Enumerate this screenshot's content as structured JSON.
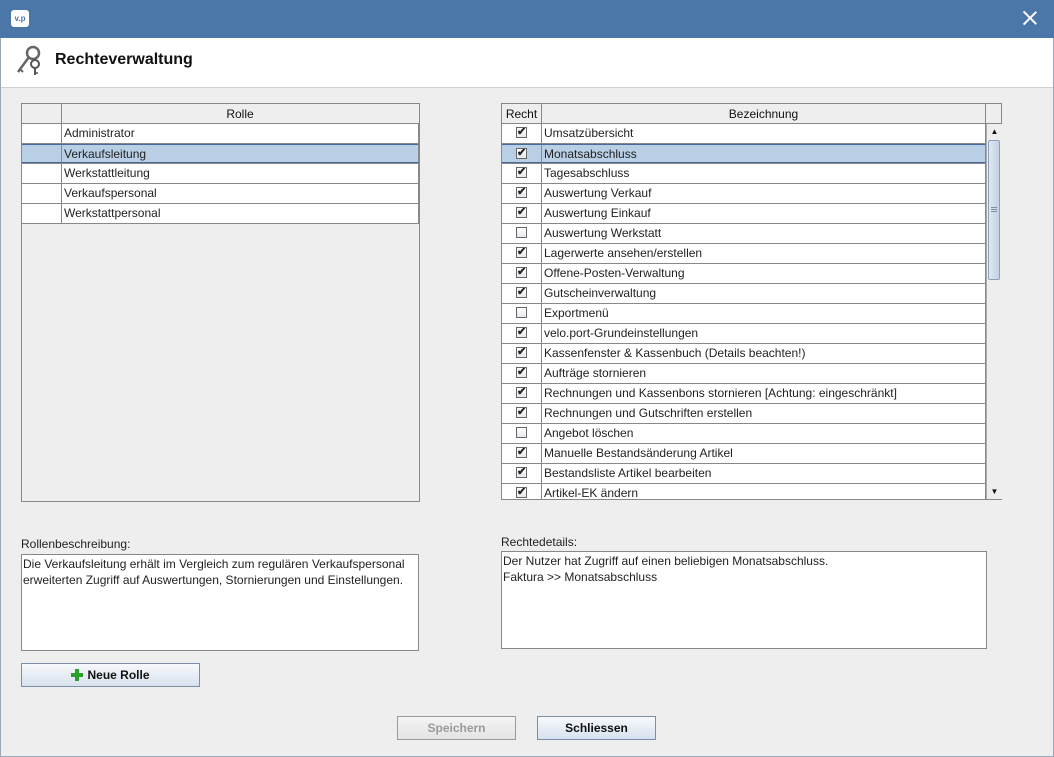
{
  "window": {
    "app_icon_text": "v.p",
    "header_title": "Rechteverwaltung"
  },
  "roles_table": {
    "columns": [
      "",
      "Rolle"
    ],
    "rows": [
      {
        "name": "Administrator",
        "selected": false
      },
      {
        "name": "Verkaufsleitung",
        "selected": true
      },
      {
        "name": "Werkstattleitung",
        "selected": false
      },
      {
        "name": "Verkaufspersonal",
        "selected": false
      },
      {
        "name": "Werkstattpersonal",
        "selected": false
      }
    ]
  },
  "rights_table": {
    "columns": [
      "Recht",
      "Bezeichnung"
    ],
    "rows": [
      {
        "checked": true,
        "label": "Umsatzübersicht",
        "selected": false
      },
      {
        "checked": true,
        "label": "Monatsabschluss",
        "selected": true
      },
      {
        "checked": true,
        "label": "Tagesabschluss",
        "selected": false
      },
      {
        "checked": true,
        "label": "Auswertung Verkauf",
        "selected": false
      },
      {
        "checked": true,
        "label": "Auswertung Einkauf",
        "selected": false
      },
      {
        "checked": false,
        "label": "Auswertung Werkstatt",
        "selected": false
      },
      {
        "checked": true,
        "label": "Lagerwerte ansehen/erstellen",
        "selected": false
      },
      {
        "checked": true,
        "label": "Offene-Posten-Verwaltung",
        "selected": false
      },
      {
        "checked": true,
        "label": "Gutscheinverwaltung",
        "selected": false
      },
      {
        "checked": false,
        "label": "Exportmenü",
        "selected": false
      },
      {
        "checked": true,
        "label": "velo.port-Grundeinstellungen",
        "selected": false
      },
      {
        "checked": true,
        "label": "Kassenfenster & Kassenbuch (Details beachten!)",
        "selected": false
      },
      {
        "checked": true,
        "label": "Aufträge stornieren",
        "selected": false
      },
      {
        "checked": true,
        "label": "Rechnungen und Kassenbons stornieren [Achtung: eingeschränkt]",
        "selected": false
      },
      {
        "checked": true,
        "label": "Rechnungen und Gutschriften erstellen",
        "selected": false
      },
      {
        "checked": false,
        "label": "Angebot löschen",
        "selected": false
      },
      {
        "checked": true,
        "label": "Manuelle Bestandsänderung Artikel",
        "selected": false
      },
      {
        "checked": true,
        "label": "Bestandsliste Artikel bearbeiten",
        "selected": false
      },
      {
        "checked": true,
        "label": "Artikel-EK ändern",
        "selected": false
      }
    ]
  },
  "role_description": {
    "label": "Rollenbeschreibung:",
    "lines": [
      "Die Verkaufsleitung erhält im Vergleich zum regulären Verkaufspersonal",
      "erweiterten Zugriff auf Auswertungen, Stornierungen und Einstellungen."
    ]
  },
  "right_details": {
    "label": "Rechtedetails:",
    "lines": [
      "Der Nutzer hat Zugriff auf einen beliebigen Monatsabschluss.",
      "Faktura >> Monatsabschluss"
    ]
  },
  "buttons": {
    "new_role": "Neue Rolle",
    "save": "Speichern",
    "close": "Schliessen"
  },
  "icons": {
    "app": "app-logo-icon",
    "header": "keys-icon",
    "close": "close-icon",
    "new_role": "plus-icon"
  }
}
